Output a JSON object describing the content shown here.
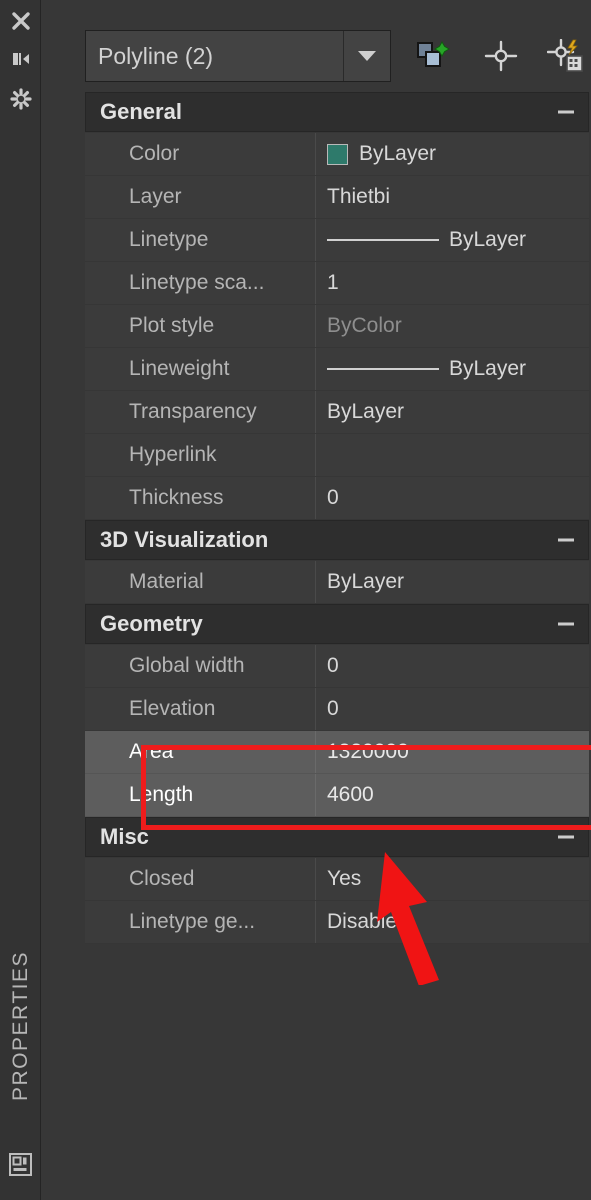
{
  "panel": {
    "title": "PROPERTIES",
    "rail_icons": [
      "close-icon",
      "auto-hide-icon",
      "settings-gear-icon",
      "panel-dock-icon"
    ],
    "accent_highlight_color": "#ee1c1c",
    "color_swatch_hex": "#2e7a6b"
  },
  "selector": {
    "value": "Polyline (2)",
    "dropdown_icon": "chevron-down-icon",
    "buttons": [
      {
        "name": "select-objects-button",
        "icon": "select-objects-icon"
      },
      {
        "name": "quick-select-button",
        "icon": "quick-select-crosshair-icon"
      },
      {
        "name": "quick-calc-button",
        "icon": "quick-calc-icon"
      }
    ]
  },
  "sections": [
    {
      "title": "General",
      "collapse_label": "−",
      "rows": [
        {
          "label": "Color",
          "value": "ByLayer",
          "kind": "color"
        },
        {
          "label": "Layer",
          "value": "Thietbi",
          "kind": "text"
        },
        {
          "label": "Linetype",
          "value": "ByLayer",
          "kind": "line"
        },
        {
          "label": "Linetype sca...",
          "value": "1",
          "kind": "text"
        },
        {
          "label": "Plot style",
          "value": "ByColor",
          "kind": "dim"
        },
        {
          "label": "Lineweight",
          "value": "ByLayer",
          "kind": "line"
        },
        {
          "label": "Transparency",
          "value": "ByLayer",
          "kind": "text"
        },
        {
          "label": "Hyperlink",
          "value": "",
          "kind": "text"
        },
        {
          "label": "Thickness",
          "value": "0",
          "kind": "text"
        }
      ]
    },
    {
      "title": "3D Visualization",
      "collapse_label": "−",
      "rows": [
        {
          "label": "Material",
          "value": "ByLayer",
          "kind": "text"
        }
      ]
    },
    {
      "title": "Geometry",
      "collapse_label": "−",
      "rows": [
        {
          "label": "Global width",
          "value": "0",
          "kind": "text"
        },
        {
          "label": "Elevation",
          "value": "0",
          "kind": "text"
        },
        {
          "label": "Area",
          "value": "1320000",
          "kind": "text",
          "highlight": true
        },
        {
          "label": "Length",
          "value": "4600",
          "kind": "text",
          "highlight": true
        }
      ]
    },
    {
      "title": "Misc",
      "collapse_label": "−",
      "rows": [
        {
          "label": "Closed",
          "value": "Yes",
          "kind": "text"
        },
        {
          "label": "Linetype ge...",
          "value": "Disabled",
          "kind": "text"
        }
      ]
    }
  ]
}
